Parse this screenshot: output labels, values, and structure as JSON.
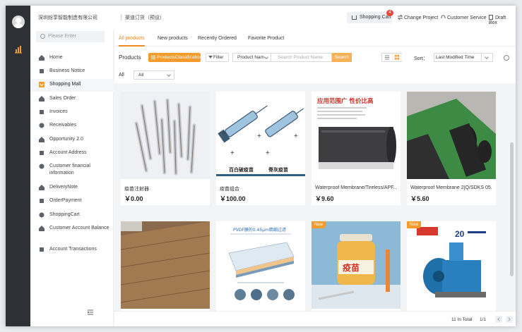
{
  "topbar": {
    "company": "深圳纷享智能制造有限公司",
    "order_type": "渠道订货（预设）",
    "cart_label": "Shopping Cart",
    "cart_count": "4",
    "change_project": "Change Project",
    "customer_service": "Customer Service",
    "draft_box": "Draft Box"
  },
  "sidebar": {
    "search_placeholder": "Please Enter",
    "items": [
      {
        "label": "Home",
        "icon": "home-icon"
      },
      {
        "label": "Business Notice",
        "icon": "bell-icon"
      },
      {
        "label": "Shopping Mall",
        "icon": "mall-icon"
      },
      {
        "label": "Sales Order",
        "icon": "order-icon"
      },
      {
        "label": "Invoices",
        "icon": "invoice-icon"
      },
      {
        "label": "Receivables",
        "icon": "receivables-icon"
      },
      {
        "label": "Opportunity 2.0",
        "icon": "target-icon"
      },
      {
        "label": "Account Address",
        "icon": "address-icon"
      },
      {
        "label": "Customer financial information",
        "icon": "finance-icon"
      },
      {
        "label": "DeliveryNote",
        "icon": "delivery-icon"
      },
      {
        "label": "OrderPayment",
        "icon": "payment-icon"
      },
      {
        "label": "ShoppingCart",
        "icon": "cart-icon"
      },
      {
        "label": "Customer Account Balance",
        "icon": "balance-icon"
      },
      {
        "label": "Account Transactions",
        "icon": "transactions-icon"
      }
    ],
    "active_index": 2
  },
  "tabs": [
    "All products",
    "New products",
    "Recently  Ordered",
    "Favorite Product"
  ],
  "toolbar": {
    "title": "Products",
    "classification_label": "ProductsClassification",
    "filter_label": "Filter",
    "field_select": "Product Nam",
    "search_placeholder": "Search Product Name",
    "search_button": "Search",
    "sort_label": "Sort：",
    "sort_value": "Last Modified Time"
  },
  "filter_row": {
    "label": "All",
    "select": "All"
  },
  "products": [
    {
      "name": "疫苗注射器",
      "price": "￥0.00",
      "new": false
    },
    {
      "name": "疫苗组合",
      "price": "￥100.00",
      "new": false
    },
    {
      "name": "Waterproof Membrane/Tireless/APF...",
      "price": "￥9.60",
      "new": false
    },
    {
      "name": "Waterproof Membrane 2[Q/SDKS 05...",
      "price": "￥5.60",
      "new": false
    },
    {
      "name": "",
      "price": "",
      "new": false
    },
    {
      "name": "",
      "price": "",
      "new": false
    },
    {
      "name": "",
      "price": "",
      "new": true
    },
    {
      "name": "",
      "price": "",
      "new": true
    }
  ],
  "image_text": {
    "syringe_left": "百白破疫苗",
    "syringe_right": "脊灰疫苗",
    "membrane_banner": "应用范围广 性价比高",
    "filter_title": "PVDF膜的0.45μm精细过滤",
    "jar_label": "疫苗",
    "anniv": "20"
  },
  "new_tag": "New",
  "pager": {
    "total": "11  In Total",
    "page": "1/1"
  },
  "colors": {
    "accent": "#f39c2b",
    "sidebar_dark": "#2d3035",
    "badge": "#e8453c"
  }
}
